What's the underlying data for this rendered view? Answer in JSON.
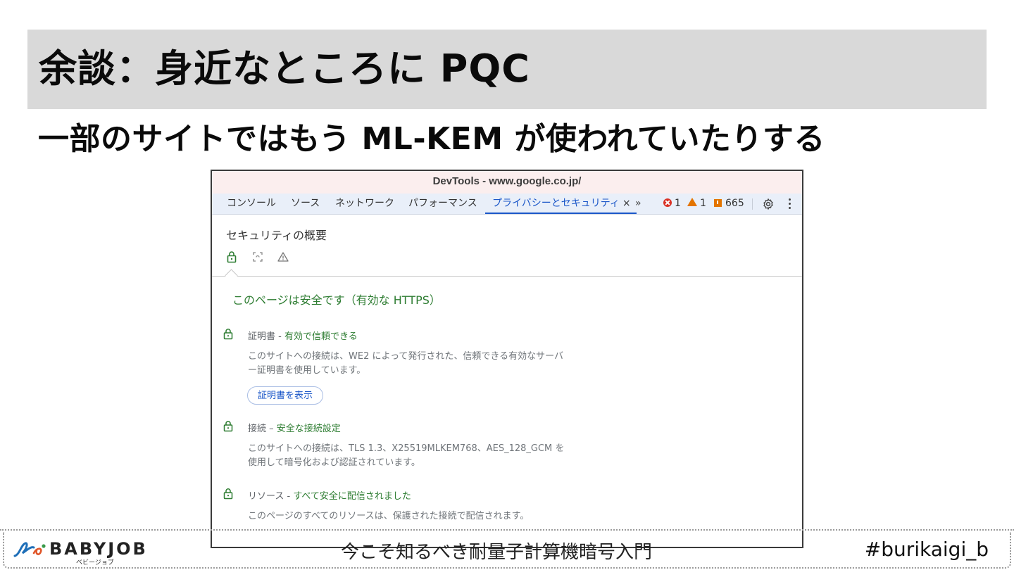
{
  "slide": {
    "title": "余談：身近なところに PQC",
    "subtitle": "一部のサイトではもう ML-KEM が使われていたりする"
  },
  "footer": {
    "logo_text": "BABYJOB",
    "logo_kana": "ベビージョブ",
    "center_text": "今こそ知るべき耐量子計算機暗号入門",
    "hashtag": "#burikaigi_b"
  },
  "devtools": {
    "window_title": "DevTools - www.google.co.jp/",
    "tabs": [
      {
        "label": "コンソール"
      },
      {
        "label": "ソース"
      },
      {
        "label": "ネットワーク"
      },
      {
        "label": "パフォーマンス"
      },
      {
        "label": "プライバシーとセキュリティ",
        "active": true
      }
    ],
    "tab_close": "×",
    "more_tabs": "»",
    "counters": {
      "errors": "1",
      "warnings": "1",
      "issues": "665"
    },
    "icons": {
      "close": "close-icon",
      "more": "chevron-double-right-icon",
      "error": "error-icon",
      "warning": "warning-icon",
      "issue": "issue-icon",
      "settings": "gear-icon",
      "menu": "kebab-menu-icon"
    },
    "colors": {
      "accent": "#1a56c8",
      "secure": "#2e7d32",
      "error": "#d93025",
      "warning": "#e37400"
    },
    "security": {
      "heading": "セキュリティの概要",
      "status": "このページは安全です（有効な HTTPS）",
      "sections": [
        {
          "label": "証明書",
          "separator": " - ",
          "value": "有効で信頼できる",
          "description": "このサイトへの接続は、WE2 によって発行された、信頼できる有効なサーバー証明書を使用しています。",
          "button": "証明書を表示"
        },
        {
          "label": "接続",
          "separator": " – ",
          "value": "安全な接続設定",
          "description": "このサイトへの接続は、TLS 1.3、X25519MLKEM768、AES_128_GCM を使用して暗号化および認証されています。"
        },
        {
          "label": "リソース",
          "separator": " - ",
          "value": "すべて安全に配信されました",
          "description": "このページのすべてのリソースは、保護された接続で配信されます。"
        }
      ]
    }
  }
}
